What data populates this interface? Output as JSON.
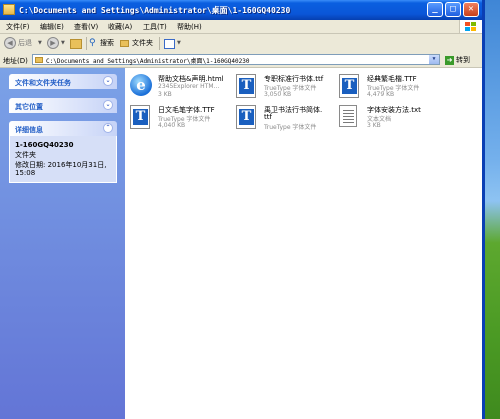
{
  "window": {
    "title": "C:\\Documents and Settings\\Administrator\\桌面\\1-160GQ40230",
    "controls": {
      "minimize": "_",
      "maximize": "□",
      "close": "✕"
    }
  },
  "menu": {
    "items": [
      "文件(F)",
      "编辑(E)",
      "查看(V)",
      "收藏(A)",
      "工具(T)",
      "帮助(H)"
    ]
  },
  "toolbar": {
    "back_label": "后退",
    "search_label": "搜索",
    "folders_label": "文件夹"
  },
  "address": {
    "label": "地址(D)",
    "value": "C:\\Documents and Settings\\Administrator\\桌面\\1-160GQ40230",
    "go_label": "转到"
  },
  "taskpane": {
    "sections": [
      {
        "title": "文件和文件夹任务"
      },
      {
        "title": "其它位置"
      },
      {
        "title": "详细信息"
      }
    ],
    "details": {
      "name": "1-160GQ40230",
      "type": "文件夹",
      "modified_label": "修改日期: 2016年10月31日,",
      "modified_time": "15:08"
    }
  },
  "files": [
    {
      "name": "帮助文档&声明.html",
      "type": "2345Explorer HTM...",
      "size": "3 KB",
      "icon": "ie-icon"
    },
    {
      "name": "专职标准行书体.ttf",
      "type": "TrueType 字体文件",
      "size": "3,050 KB",
      "icon": "font-icon"
    },
    {
      "name": "经典繁毛楷.TTF",
      "type": "TrueType 字体文件",
      "size": "4,479 KB",
      "icon": "font-icon"
    },
    {
      "name": "日文毛笔字体.TTF",
      "type": "TrueType 字体文件",
      "size": "4,040 KB",
      "icon": "font-icon"
    },
    {
      "name": "禹卫书法行书简体.",
      "name2": "ttf",
      "type": "TrueType 字体文件",
      "size": "",
      "icon": "font-icon"
    },
    {
      "name": "字体安装方法.txt",
      "type": "文本文档",
      "size": "3 KB",
      "icon": "text-icon"
    }
  ]
}
